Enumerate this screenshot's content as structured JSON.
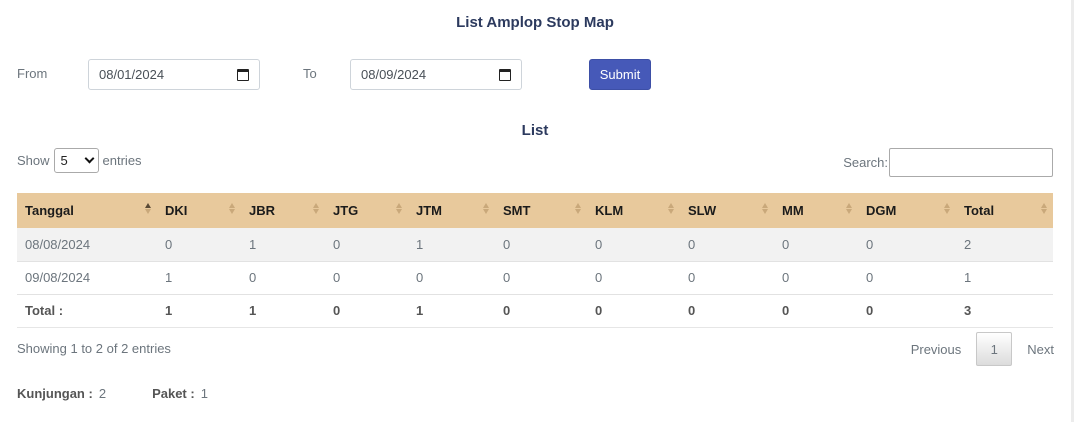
{
  "page": {
    "title": "List Amplop Stop Map"
  },
  "filter": {
    "from_label": "From",
    "from_value": "08/01/2024",
    "to_label": "To",
    "to_value": "08/09/2024",
    "submit_label": "Submit"
  },
  "list": {
    "title": "List",
    "show_label": "Show",
    "entries_value": "5",
    "entries_label": "entries",
    "search_label": "Search:",
    "search_value": ""
  },
  "table": {
    "columns": [
      "Tanggal",
      "DKI",
      "JBR",
      "JTG",
      "JTM",
      "SMT",
      "KLM",
      "SLW",
      "MM",
      "DGM",
      "Total"
    ],
    "rows": [
      [
        "08/08/2024",
        "0",
        "1",
        "0",
        "1",
        "0",
        "0",
        "0",
        "0",
        "0",
        "2"
      ],
      [
        "09/08/2024",
        "1",
        "0",
        "0",
        "0",
        "0",
        "0",
        "0",
        "0",
        "0",
        "1"
      ]
    ],
    "footer": [
      "Total :",
      "1",
      "1",
      "0",
      "1",
      "0",
      "0",
      "0",
      "0",
      "0",
      "3"
    ]
  },
  "info": {
    "text": "Showing 1 to 2 of 2 entries"
  },
  "pagination": {
    "previous": "Previous",
    "page": "1",
    "next": "Next"
  },
  "summary": {
    "kunjungan_label": "Kunjungan :",
    "kunjungan_value": "2",
    "paket_label": "Paket :",
    "paket_value": "1"
  },
  "colors": {
    "header_bg": "#e8c99c",
    "submit_bg": "#4659b8",
    "title": "#2c3a5e"
  }
}
